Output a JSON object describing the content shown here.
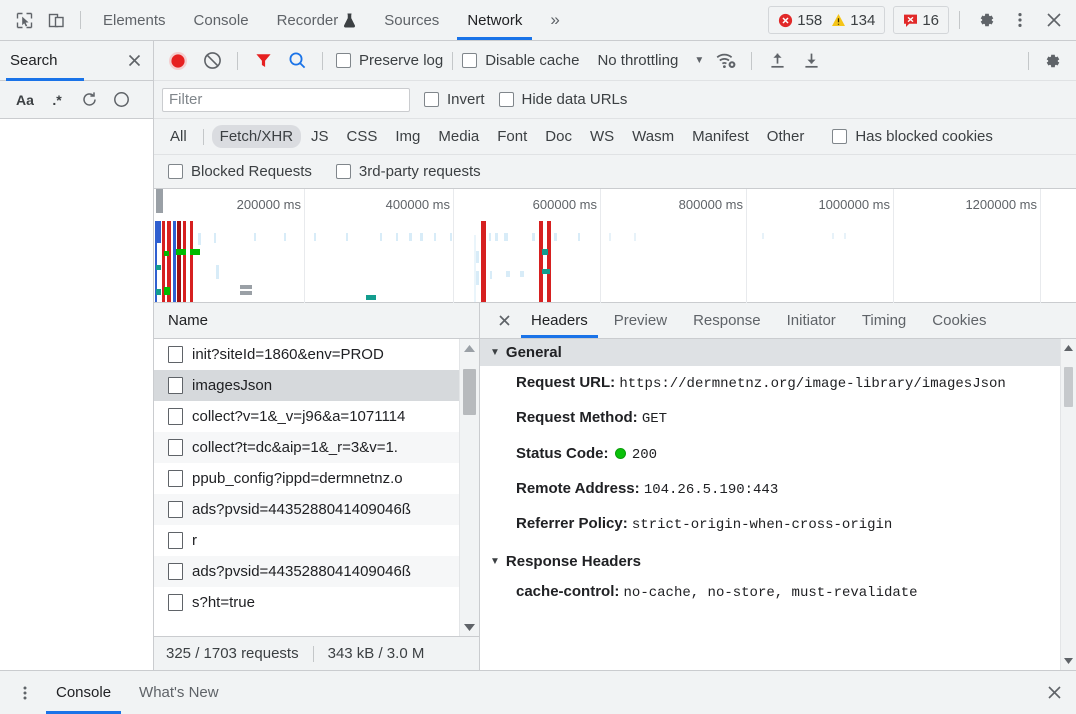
{
  "main_tabs": {
    "inspect_icon": "inspect-cursor-icon",
    "device_icon": "device-toolbar-icon",
    "items": [
      {
        "label": "Elements",
        "active": false,
        "icon": null
      },
      {
        "label": "Console",
        "active": false,
        "icon": null
      },
      {
        "label": "Recorder",
        "active": false,
        "icon": "flask-icon"
      },
      {
        "label": "Sources",
        "active": false,
        "icon": null
      },
      {
        "label": "Network",
        "active": true,
        "icon": null
      }
    ],
    "more_label": "»",
    "errors_count": "158",
    "warnings_count": "134",
    "issues_count": "16",
    "settings_icon": "gear-icon",
    "more_options_icon": "kebab-menu-icon",
    "close_icon": "close-icon"
  },
  "search_pane": {
    "title": "Search",
    "close_icon": "close-icon",
    "tools": [
      {
        "label": "Aa",
        "name": "match-case-toggle"
      },
      {
        "label": ".*",
        "name": "regex-toggle"
      },
      {
        "label": "",
        "name": "refresh-icon"
      },
      {
        "label": "",
        "name": "clear-icon"
      }
    ]
  },
  "network_toolbar": {
    "record_icon": "record-button-icon",
    "clear_icon": "clear-requests-icon",
    "filter_icon": "filter-funnel-icon",
    "search_icon": "search-icon",
    "preserve_log_label": "Preserve log",
    "preserve_log_checked": false,
    "disable_cache_label": "Disable cache",
    "disable_cache_checked": false,
    "throttling_label": "No throttling",
    "throttling_caret": "▼",
    "network_conditions_icon": "wifi-gear-icon",
    "import_har_icon": "upload-arrow-icon",
    "export_har_icon": "download-arrow-icon",
    "settings_icon": "gear-icon"
  },
  "filter_bar": {
    "filter_placeholder": "Filter",
    "filter_value": "",
    "invert_label": "Invert",
    "invert_checked": false,
    "hide_data_urls_label": "Hide data URLs",
    "hide_data_urls_checked": false
  },
  "type_bar": {
    "types": [
      {
        "label": "All",
        "active": false
      },
      {
        "label": "Fetch/XHR",
        "active": true
      },
      {
        "label": "JS",
        "active": false
      },
      {
        "label": "CSS",
        "active": false
      },
      {
        "label": "Img",
        "active": false
      },
      {
        "label": "Media",
        "active": false
      },
      {
        "label": "Font",
        "active": false
      },
      {
        "label": "Doc",
        "active": false
      },
      {
        "label": "WS",
        "active": false
      },
      {
        "label": "Wasm",
        "active": false
      },
      {
        "label": "Manifest",
        "active": false
      },
      {
        "label": "Other",
        "active": false
      }
    ],
    "has_blocked_cookies_label": "Has blocked cookies",
    "has_blocked_cookies_checked": false
  },
  "option_bar": {
    "blocked_requests_label": "Blocked Requests",
    "blocked_requests_checked": false,
    "third_party_label": "3rd-party requests",
    "third_party_checked": false
  },
  "overview": {
    "tick_labels": [
      "200000 ms",
      "400000 ms",
      "600000 ms",
      "800000 ms",
      "1000000 ms",
      "1200000 ms"
    ],
    "colors": {
      "red": "#d62020",
      "darkred": "#a01010",
      "blue": "#2f5fd0",
      "green": "#00bb00",
      "teal": "#139d8e",
      "gray": "#9aa0a6",
      "lightblue": "#d8ecf8"
    }
  },
  "request_list": {
    "column_header": "Name",
    "rows": [
      {
        "name": "init?siteId=1860&env=PROD",
        "selected": false
      },
      {
        "name": "imagesJson",
        "selected": true
      },
      {
        "name": "collect?v=1&_v=j96&a=1071114",
        "selected": false
      },
      {
        "name": "collect?t=dc&aip=1&_r=3&v=1.",
        "selected": false
      },
      {
        "name": "ppub_config?ippd=dermnetnz.o",
        "selected": false
      },
      {
        "name": "ads?pvsid=4435288041409046ß",
        "selected": false
      },
      {
        "name": "r",
        "selected": false
      },
      {
        "name": "ads?pvsid=4435288041409046ß",
        "selected": false
      },
      {
        "name": "s?ht=true",
        "selected": false
      }
    ],
    "status_requests": "325 / 1703 requests",
    "status_transfer": "343 kB / 3.0 M"
  },
  "detail": {
    "close_icon": "close-icon",
    "tabs": [
      {
        "label": "Headers",
        "active": true
      },
      {
        "label": "Preview",
        "active": false
      },
      {
        "label": "Response",
        "active": false
      },
      {
        "label": "Initiator",
        "active": false
      },
      {
        "label": "Timing",
        "active": false
      },
      {
        "label": "Cookies",
        "active": false
      }
    ],
    "general_section": {
      "title": "General",
      "caret": "▼",
      "request_url_key": "Request URL:",
      "request_url_value": "https://dermnetnz.org/image-library/imagesJson",
      "request_method_key": "Request Method:",
      "request_method_value": "GET",
      "status_code_key": "Status Code:",
      "status_code_value": "200",
      "status_indicator": "green-status-dot",
      "remote_address_key": "Remote Address:",
      "remote_address_value": "104.26.5.190:443",
      "referrer_policy_key": "Referrer Policy:",
      "referrer_policy_value": "strict-origin-when-cross-origin"
    },
    "response_headers_section": {
      "title": "Response Headers",
      "caret": "▼",
      "rows": [
        {
          "key": "cache-control:",
          "value": "no-cache, no-store, must-revalidate"
        }
      ]
    }
  },
  "drawer": {
    "menu_icon": "kebab-menu-icon",
    "tabs": [
      {
        "label": "Console",
        "active": true
      },
      {
        "label": "What's New",
        "active": false
      }
    ],
    "close_icon": "close-icon"
  }
}
